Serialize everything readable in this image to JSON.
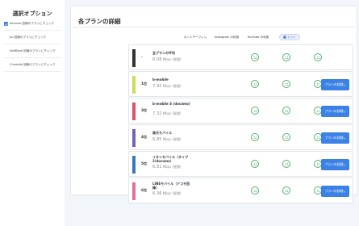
{
  "sidebar": {
    "title": "選択オプション",
    "options": [
      {
        "label": "docomo 回線のプランにチェック",
        "checked": true
      },
      {
        "label": "au 回線のプランにチェック",
        "checked": false
      },
      {
        "label": "SoftBank 回線のプランにチェック",
        "checked": false
      },
      {
        "label": "Y!mobile 回線のプランにチェック",
        "checked": false
      }
    ]
  },
  "panel": {
    "title": "各プランの詳細",
    "columns": [
      "ネットサーフィン",
      "Instagram の利用",
      "YouTube の利用"
    ],
    "hint_label": "ヒント",
    "hint_icon": "question-icon",
    "score_icon": "smile-icon",
    "detail_label": "プランの詳細",
    "detail_icon": "chevron-right-icon",
    "speed_unit": "Mbps (昼間)",
    "rows": [
      {
        "rank": "-",
        "name": "全プランの平均",
        "speed": "6.08",
        "color": "#333333",
        "scores": [
          "good",
          "good",
          "good"
        ],
        "has_detail": false
      },
      {
        "rank": "1位",
        "name": "b-mobile",
        "speed": "7.92",
        "color": "#cddc5a",
        "scores": [
          "good",
          "good",
          "good"
        ],
        "has_detail": true
      },
      {
        "rank": "3位",
        "name": "b-mobile S (docomo)",
        "speed": "7.32",
        "color": "#e0506e",
        "scores": [
          "good",
          "good",
          "good"
        ],
        "has_detail": true
      },
      {
        "rank": "4位",
        "name": "楽天モバイル",
        "speed": "6.85",
        "color": "#7661b8",
        "scores": [
          "good",
          "good",
          "good"
        ],
        "has_detail": true
      },
      {
        "rank": "5位",
        "name": "イオンモバイル（タイプ2/docomo）",
        "speed": "6.61",
        "color": "#3a76c2",
        "scores": [
          "good",
          "good",
          "good"
        ],
        "has_detail": true
      },
      {
        "rank": "6位",
        "name": "LINEモバイル（ドコモ回線）",
        "speed": "6.36",
        "color": "#e56f9c",
        "scores": [
          "good",
          "good",
          "good"
        ],
        "has_detail": true
      }
    ]
  },
  "colors": {
    "accent": "#3c82e6",
    "good": "#52b36a"
  }
}
